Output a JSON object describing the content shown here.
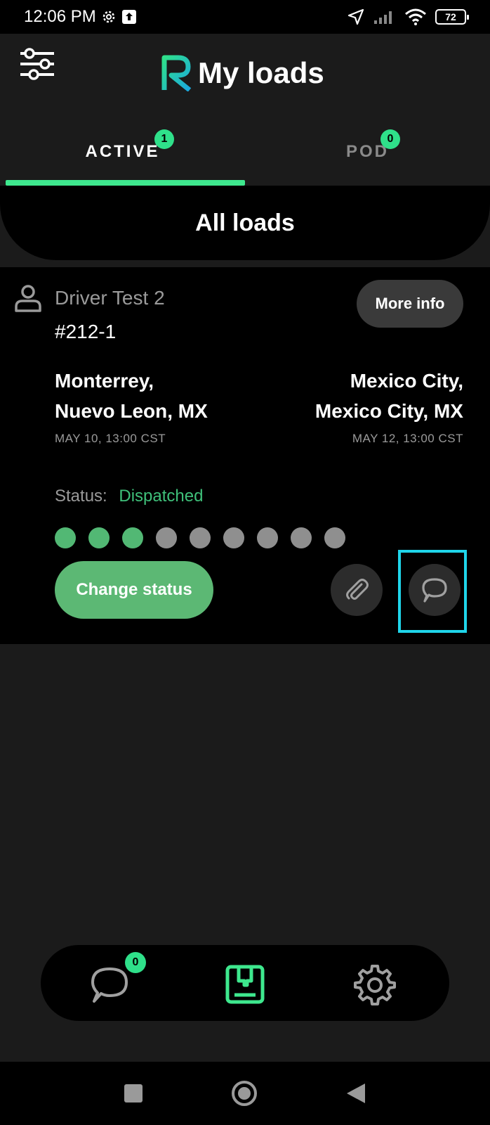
{
  "status_bar": {
    "time": "12:06 PM",
    "battery": "72"
  },
  "header": {
    "title": "My loads"
  },
  "tabs": [
    {
      "label": "ACTIVE",
      "badge": "1",
      "active": true
    },
    {
      "label": "POD",
      "badge": "0",
      "active": false
    }
  ],
  "section": {
    "title": "All loads"
  },
  "load": {
    "driver": "Driver Test 2",
    "id": "#212-1",
    "more_info_label": "More info",
    "origin": {
      "city": "Monterrey,",
      "region": "Nuevo Leon, MX",
      "date": "MAY 10, 13:00 CST"
    },
    "destination": {
      "city": "Mexico City,",
      "region": "Mexico City, MX",
      "date": "MAY 12, 13:00 CST"
    },
    "status_label": "Status:",
    "status_value": "Dispatched",
    "progress": {
      "completed": 3,
      "total": 9
    },
    "change_status_label": "Change status"
  },
  "bottom_nav": {
    "chat_badge": "0",
    "items": [
      "chat-icon",
      "loads-icon",
      "settings-icon"
    ]
  },
  "colors": {
    "accent_green": "#3ee88e",
    "status_green": "#3fc07a",
    "highlight_cyan": "#1fd5ea"
  }
}
